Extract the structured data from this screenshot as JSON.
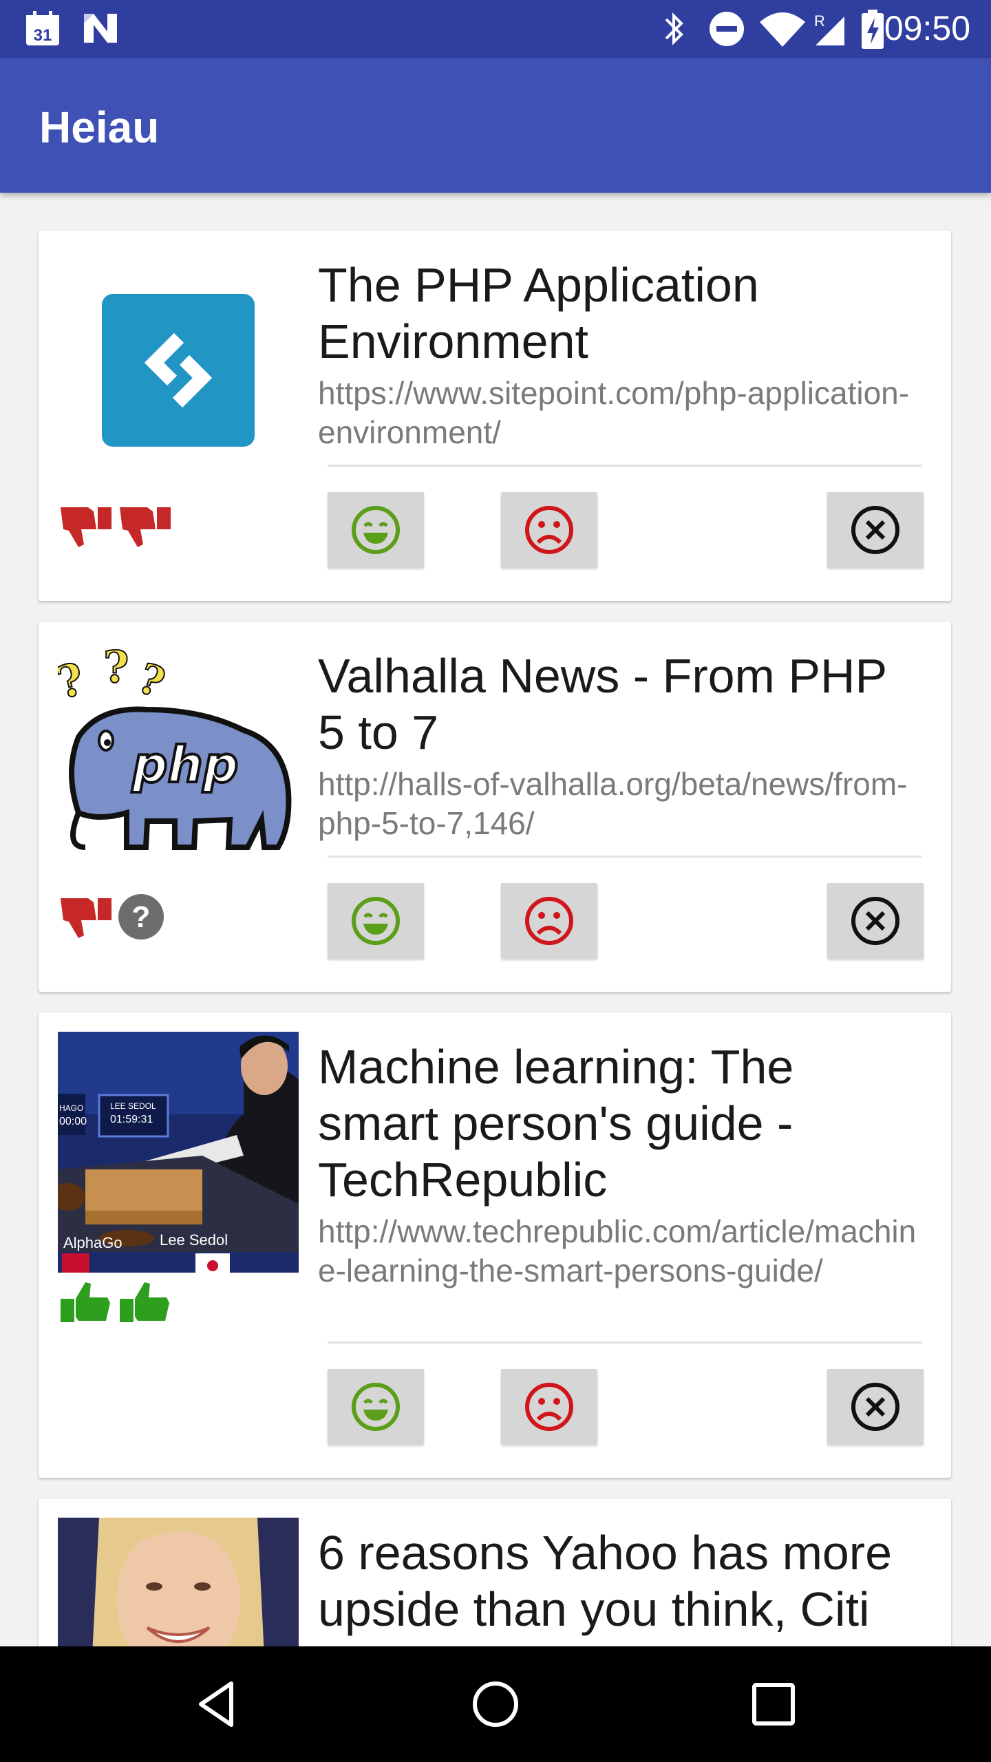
{
  "status_bar": {
    "calendar_day": "31",
    "time": "09:50",
    "icons": [
      "calendar-icon",
      "n-icon",
      "bluetooth-icon",
      "do-not-disturb-icon",
      "wifi-icon",
      "signal-roaming-icon",
      "battery-charging-icon"
    ]
  },
  "app_bar": {
    "title": "Heiau"
  },
  "colors": {
    "status_bar": "#303f9f",
    "app_bar": "#3f51b5",
    "thumb_down": "#c62828",
    "thumb_up": "#2e9e1f",
    "happy": "#5a9e1a",
    "sad": "#d0161b",
    "unknown": "#6d6d6d"
  },
  "cards": [
    {
      "title": "The PHP Application Environment",
      "url": "https://www.sitepoint.com/php-application-environment/",
      "rating_icons": [
        "thumb-down-icon",
        "thumb-down-icon"
      ]
    },
    {
      "title": "Valhalla News - From PHP 5 to 7",
      "url": "http://halls-of-valhalla.org/beta/news/from-php-5-to-7,146/",
      "thumb_text": "php",
      "rating_icons": [
        "thumb-down-icon",
        "question-icon"
      ]
    },
    {
      "title": "Machine learning: The smart person's guide - TechRepublic",
      "url": "http://www.techrepublic.com/article/machine-learning-the-smart-persons-guide/",
      "photo_captions": {
        "left": "AlphaGo",
        "right": "Lee Sedol",
        "screen_left": "HAGO 00:00",
        "screen_right": "LEE SEDOL 01:59:31"
      },
      "rating_icons": [
        "thumb-up-icon",
        "thumb-up-icon"
      ]
    },
    {
      "title": "6 reasons Yahoo has more upside than you think, Citi",
      "url": "",
      "rating_icons": []
    }
  ],
  "nav": {
    "icons": [
      "back-icon",
      "home-icon",
      "recents-icon"
    ]
  }
}
